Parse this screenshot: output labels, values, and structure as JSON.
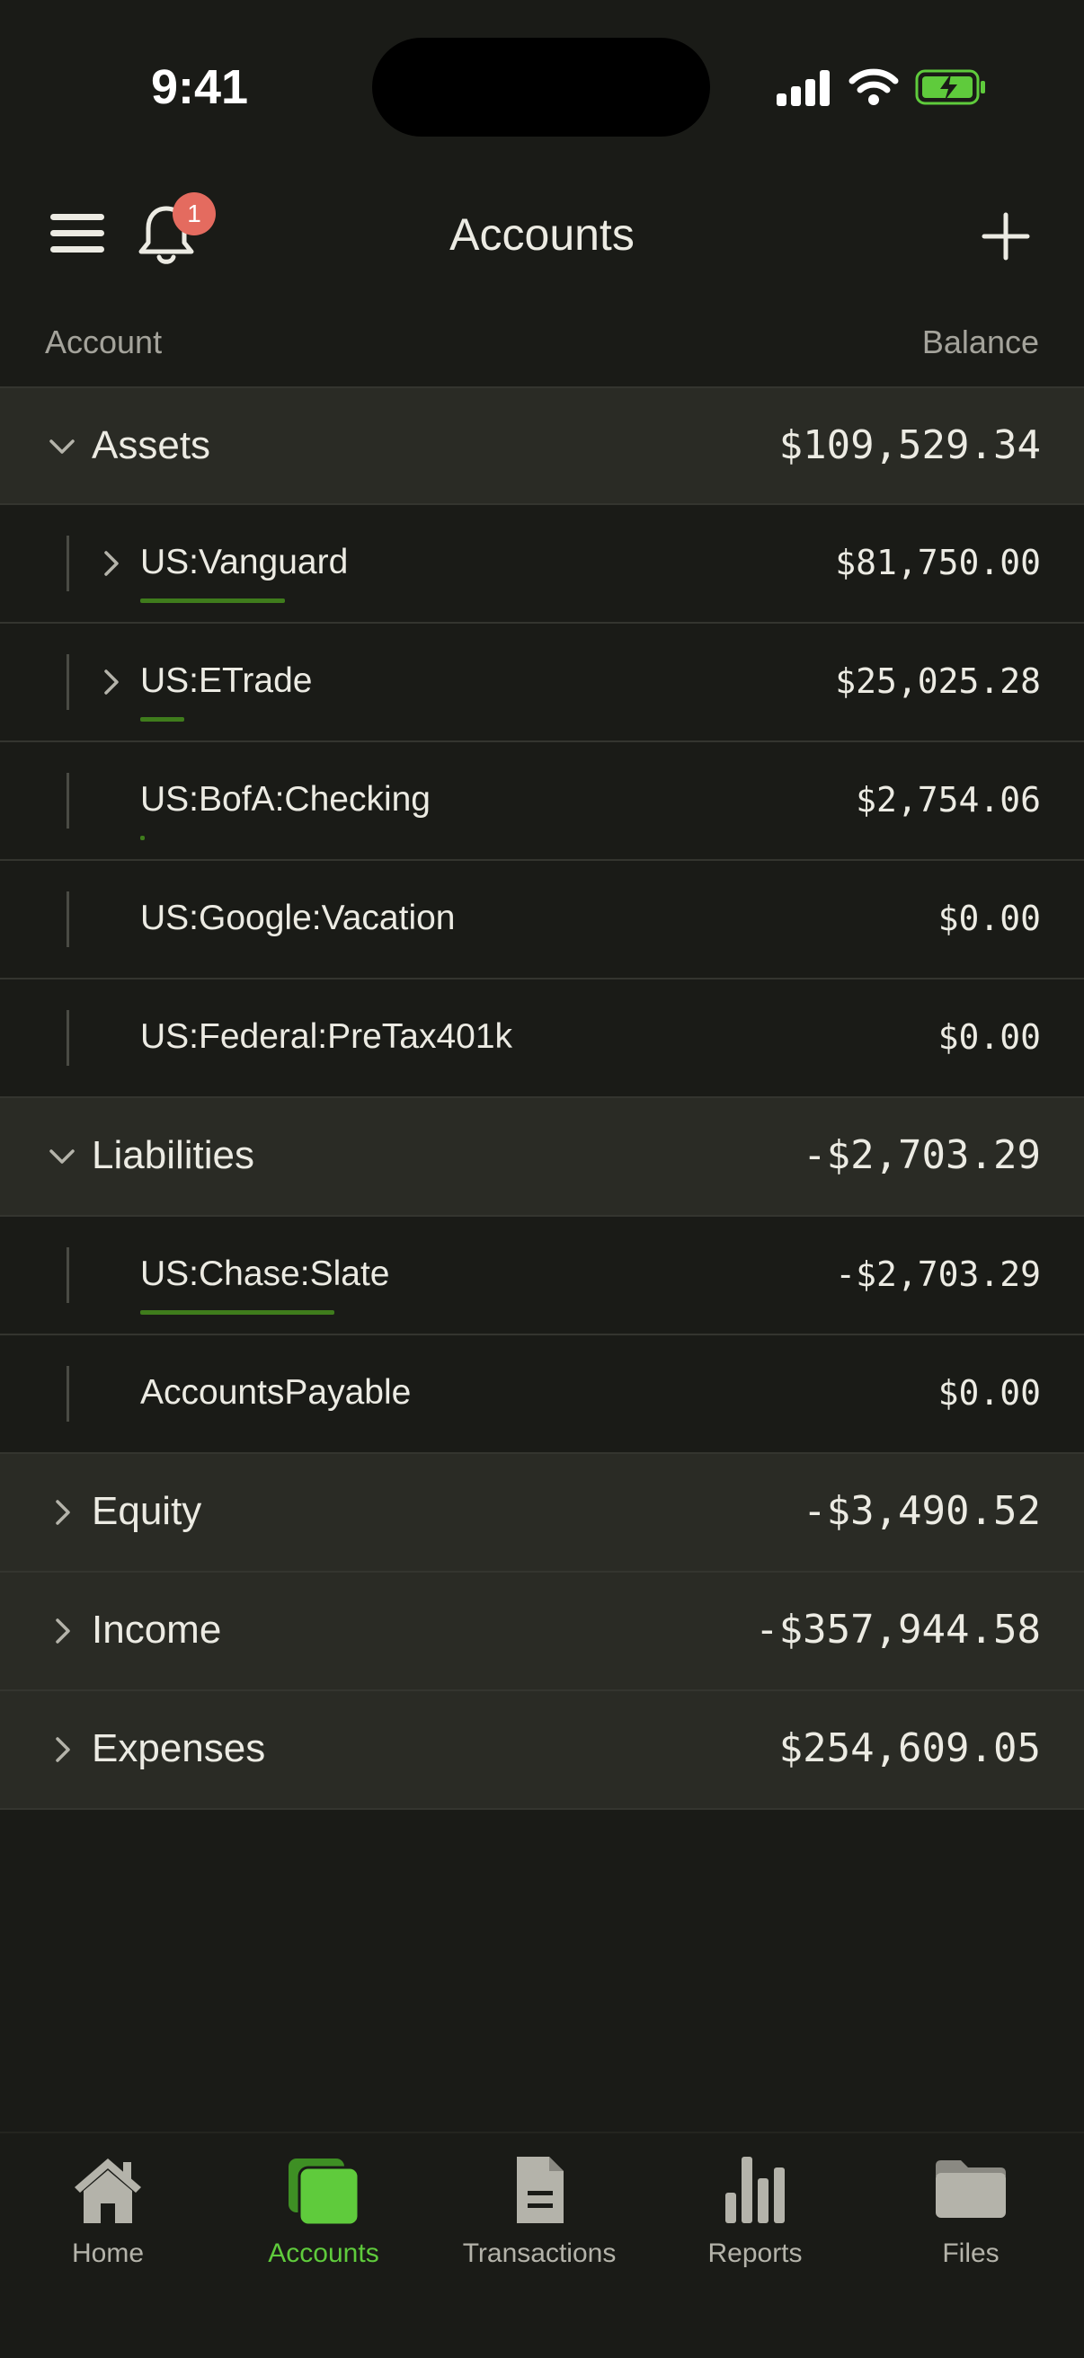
{
  "status_bar": {
    "time": "9:41"
  },
  "header": {
    "title": "Accounts",
    "notification_count": "1"
  },
  "columns": {
    "account": "Account",
    "balance": "Balance"
  },
  "accounts": {
    "assets": {
      "name": "Assets",
      "balance": "$109,529.34",
      "expanded": true,
      "children": [
        {
          "name": "US:Vanguard",
          "balance": "$81,750.00",
          "expandable": true,
          "bar_fraction": 0.746
        },
        {
          "name": "US:ETrade",
          "balance": "$25,025.28",
          "expandable": true,
          "bar_fraction": 0.228
        },
        {
          "name": "US:BofA:Checking",
          "balance": "$2,754.06",
          "expandable": false,
          "bar_fraction": 0.025
        },
        {
          "name": "US:Google:Vacation",
          "balance": "$0.00",
          "expandable": false,
          "bar_fraction": 0
        },
        {
          "name": "US:Federal:PreTax401k",
          "balance": "$0.00",
          "expandable": false,
          "bar_fraction": 0
        }
      ]
    },
    "liabilities": {
      "name": "Liabilities",
      "balance": "-$2,703.29",
      "expanded": true,
      "children": [
        {
          "name": "US:Chase:Slate",
          "balance": "-$2,703.29",
          "expandable": false,
          "bar_fraction": 1.0
        },
        {
          "name": "AccountsPayable",
          "balance": "$0.00",
          "expandable": false,
          "bar_fraction": 0
        }
      ]
    },
    "equity": {
      "name": "Equity",
      "balance": "-$3,490.52",
      "expanded": false
    },
    "income": {
      "name": "Income",
      "balance": "-$357,944.58",
      "expanded": false
    },
    "expenses": {
      "name": "Expenses",
      "balance": "$254,609.05",
      "expanded": false
    }
  },
  "tabs": {
    "home": {
      "label": "Home",
      "icon": "house-icon"
    },
    "accounts": {
      "label": "Accounts",
      "icon": "cards-icon",
      "active": true
    },
    "transactions": {
      "label": "Transactions",
      "icon": "document-icon"
    },
    "reports": {
      "label": "Reports",
      "icon": "bar-chart-icon"
    },
    "files": {
      "label": "Files",
      "icon": "folder-icon"
    }
  },
  "colors": {
    "background": "#1a1b17",
    "group_row": "#2a2b25",
    "accent_green": "#5fcb3c",
    "bar_green": "#3f7c1c",
    "badge_red": "#e46b5f"
  }
}
